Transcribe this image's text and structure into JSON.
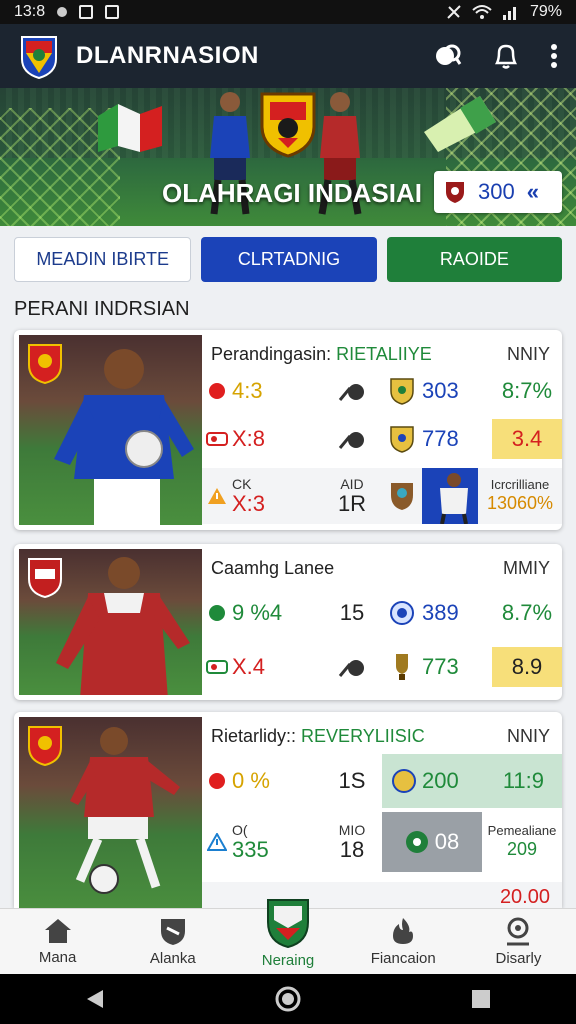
{
  "status": {
    "time": "13:8",
    "battery": "79%"
  },
  "app": {
    "title": "DLANRNASION"
  },
  "hero": {
    "title": "OLAHRAGI INDASIAI",
    "chip_value": "300",
    "chip_arrow": "«"
  },
  "tabs": [
    {
      "label": "MEADIN IBIRTE"
    },
    {
      "label": "CLRTADNIG"
    },
    {
      "label": "RAOIDE"
    }
  ],
  "section": {
    "title": "PERANI INDRSIAN"
  },
  "cards": [
    {
      "head_prefix": "Perandingasin:",
      "head_highlight": "RIETALIIYE",
      "head_right": "NNIY",
      "rows": [
        {
          "v1": "4:3",
          "v2": "303",
          "v3": "8:7%"
        },
        {
          "v1": "X:8",
          "v2": "778",
          "v3": "3.4"
        },
        {
          "small_a": "CK",
          "v1": "X:3",
          "small_b": "AID",
          "v2": "1R",
          "right_a": "Icrcrilliane",
          "right_b": "13060%"
        }
      ]
    },
    {
      "head_prefix": "Caamhg Lanee",
      "head_highlight": "",
      "head_right": "MMIY",
      "rows": [
        {
          "v1": "9 %4",
          "mid": "15",
          "v2": "389",
          "v3": "8.7%"
        },
        {
          "v1": "X.4",
          "v2": "773",
          "v3": "8.9"
        }
      ]
    },
    {
      "head_prefix": "Rietarlidy::",
      "head_highlight": "REVERYLIISIC",
      "head_right": "NNIY",
      "rows": [
        {
          "v1": "0 %",
          "mid": "1S",
          "v2": "200",
          "v3": "11:9"
        },
        {
          "small_a": "O(",
          "v1": "335",
          "small_b": "MIO",
          "mid": "18",
          "v2": "08",
          "right_a": "Pemealiane",
          "right_b": "209"
        },
        {
          "v3": "20.00"
        }
      ]
    }
  ],
  "nav": [
    {
      "label": "Mana"
    },
    {
      "label": "Alanka"
    },
    {
      "label": "Neraing"
    },
    {
      "label": "Fiancaion"
    },
    {
      "label": "Disarly"
    }
  ],
  "colors": {
    "primary": "#1b43b8",
    "green": "#1f7f3a",
    "appbar": "#1c2530"
  }
}
